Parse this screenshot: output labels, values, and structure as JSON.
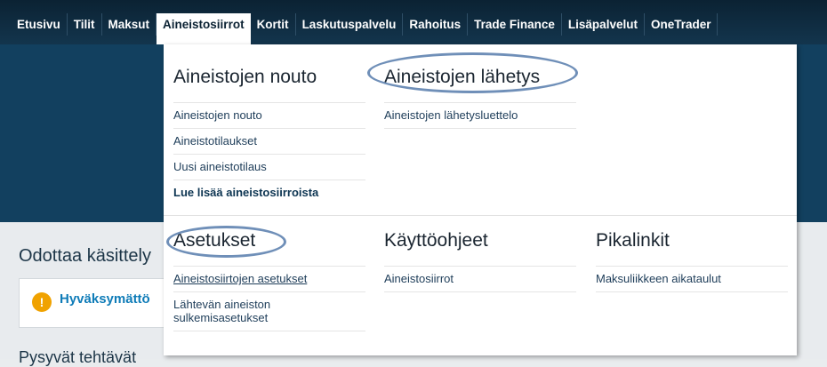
{
  "nav": {
    "items": [
      {
        "label": "Etusivu"
      },
      {
        "label": "Tilit"
      },
      {
        "label": "Maksut"
      },
      {
        "label": "Aineistosiirrot",
        "active": true
      },
      {
        "label": "Kortit"
      },
      {
        "label": "Laskutuspalvelu"
      },
      {
        "label": "Rahoitus"
      },
      {
        "label": "Trade Finance"
      },
      {
        "label": "Lisäpalvelut"
      },
      {
        "label": "OneTrader"
      }
    ]
  },
  "mega": {
    "nouto": {
      "title": "Aineistojen nouto",
      "links": [
        "Aineistojen nouto",
        "Aineistotilaukset",
        "Uusi aineistotilaus"
      ],
      "more": "Lue lisää aineistosiirroista"
    },
    "lahetys": {
      "title": "Aineistojen lähetys",
      "links": [
        "Aineistojen lähetysluettelo"
      ]
    },
    "asetukset": {
      "title": "Asetukset",
      "links": [
        "Aineistosiirtojen asetukset",
        "Lähtevän aineiston sulkemisasetukset"
      ]
    },
    "ohjeet": {
      "title": "Käyttöohjeet",
      "links": [
        "Aineistosiirrot"
      ]
    },
    "pikalinkit": {
      "title": "Pikalinkit",
      "links": [
        "Maksuliikkeen aikataulut"
      ]
    }
  },
  "page": {
    "pending_title": "Odottaa käsittely",
    "notice_icon": "!",
    "notice_text": "Hyväksymättö",
    "bottom_text": "Pysyvät tehtävät"
  },
  "colors": {
    "nav_bg": "#0b2233",
    "banner": "#12405f",
    "annotation_ellipse": "#6f8fb8",
    "warning": "#f0a200",
    "link": "#0f7cb8"
  }
}
